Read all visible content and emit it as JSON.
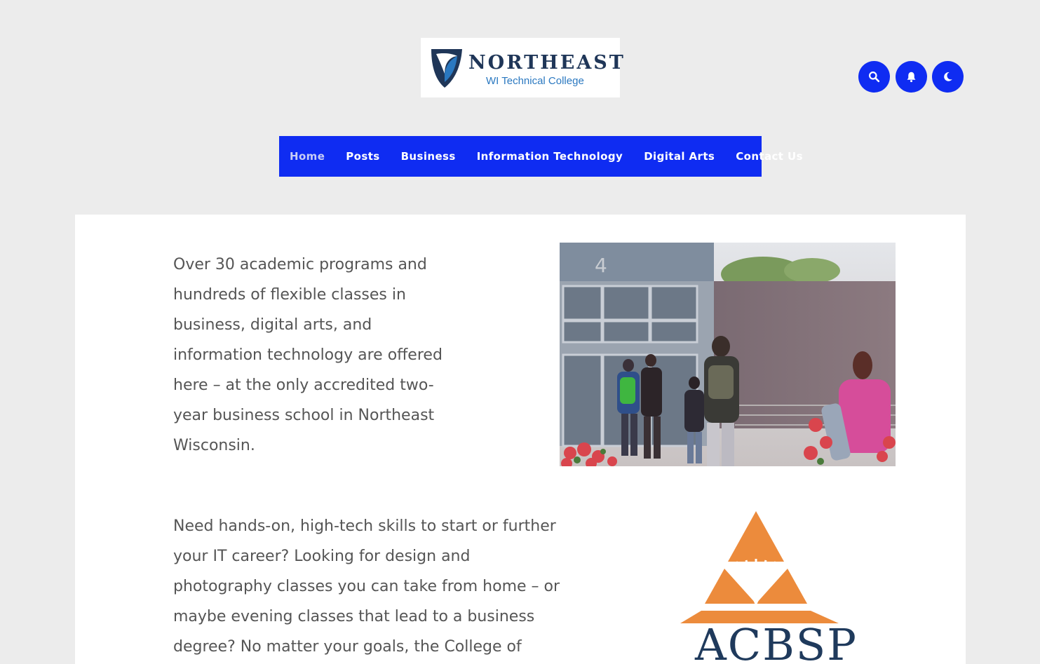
{
  "header": {
    "logo_name": "NORTHEAST",
    "logo_subtitle": "WI Technical College",
    "icons": {
      "search": "search-icon",
      "bell": "bell-icon",
      "moon": "moon-icon"
    },
    "accent_color": "#0f2cf2"
  },
  "nav": {
    "items": [
      {
        "label": "Home"
      },
      {
        "label": "Posts"
      },
      {
        "label": "Business"
      },
      {
        "label": "Information Technology"
      },
      {
        "label": "Digital Arts"
      },
      {
        "label": "Contact Us"
      }
    ],
    "active": "Home"
  },
  "main": {
    "paragraph1": "Over 30 academic programs and hundreds of flexible classes in business, digital arts, and information technology are offered here – at the only accredited two-year business school in Northeast Wisconsin.",
    "paragraph2": "Need hands-on, high-tech skills to start or further your IT career? Looking for design and photography classes you can take from home – or maybe evening classes that lead to a business degree? No matter your goals, the College of",
    "logo_text": "ACBSP"
  }
}
